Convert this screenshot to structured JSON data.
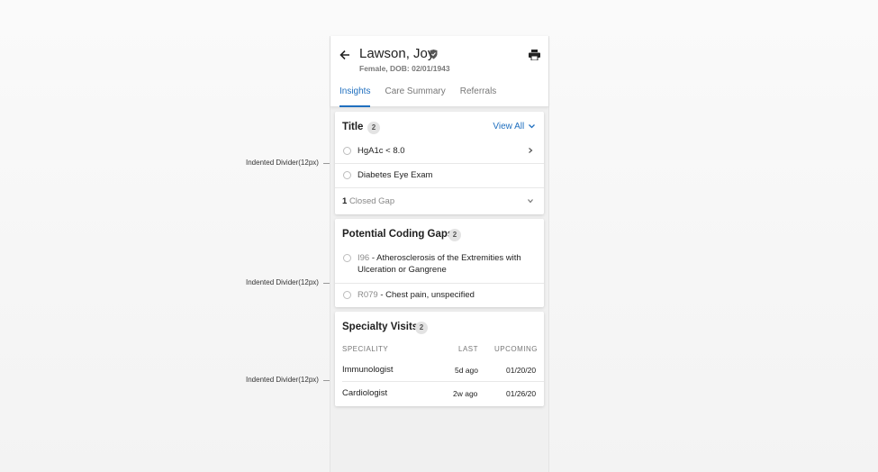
{
  "patient": {
    "name": "Lawson, Joy",
    "meta": "Female, DOB: 02/01/1943"
  },
  "tabs": [
    {
      "label": "Insights",
      "active": true
    },
    {
      "label": "Care Summary",
      "active": false
    },
    {
      "label": "Referrals",
      "active": false
    }
  ],
  "gaps_card": {
    "title": "Title",
    "count": "2",
    "view_all": "View All",
    "items": [
      "HgA1c < 8.0",
      "Diabetes Eye Exam"
    ],
    "closed_count": "1",
    "closed_label": "Closed Gap"
  },
  "coding_card": {
    "title": "Potential Coding Gaps",
    "count": "2",
    "items": [
      {
        "code": "I96",
        "desc": "- Atherosclerosis of the Extremities with Ulceration or Gangrene"
      },
      {
        "code": "R079",
        "desc": "- Chest pain, unspecified"
      }
    ]
  },
  "visits_card": {
    "title": "Specialty Visits",
    "count": "2",
    "headers": {
      "speciality": "SPECIALITY",
      "last": "LAST",
      "upcoming": "UPCOMING"
    },
    "rows": [
      {
        "speciality": "Immunologist",
        "last": "5d ago",
        "upcoming": "01/20/20"
      },
      {
        "speciality": "Cardiologist",
        "last": "2w ago",
        "upcoming": "01/26/20"
      }
    ]
  },
  "annotations": [
    "Indented Divider(12px)",
    "Indented Divider(12px)",
    "Indented Divider(12px)"
  ],
  "colors": {
    "accent": "#1f6fbf",
    "background": "#f4f4f4",
    "card": "#ffffff"
  },
  "icons": {
    "back": "arrow-left-icon",
    "shield": "shield-icon",
    "print": "printer-icon"
  }
}
